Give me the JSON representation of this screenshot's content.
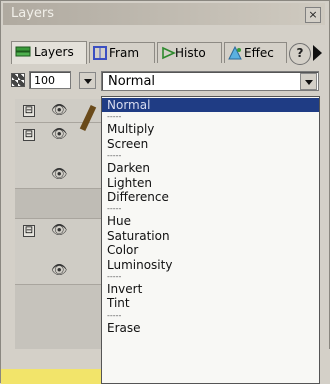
{
  "window": {
    "title": "Layers",
    "close_glyph": "×"
  },
  "tabs": [
    {
      "label": "Layers",
      "icon": "layers-icon"
    },
    {
      "label": "Fram",
      "icon": "frames-icon"
    },
    {
      "label": "Histo",
      "icon": "history-icon"
    },
    {
      "label": "Effec",
      "icon": "effects-icon"
    }
  ],
  "help": {
    "glyph": "?"
  },
  "opacity": {
    "value": "100",
    "icon": "opacity-icon"
  },
  "blend_mode": {
    "selected": "Normal"
  },
  "layer_rows": {
    "expander_glyph": "⊟",
    "eye_glyph": "👁"
  },
  "blend_options": [
    {
      "label": "Normal",
      "selected": true
    },
    {
      "label": "-----"
    },
    {
      "label": "Multiply"
    },
    {
      "label": "Screen"
    },
    {
      "label": "-----"
    },
    {
      "label": "Darken"
    },
    {
      "label": "Lighten"
    },
    {
      "label": "Difference"
    },
    {
      "label": "-----"
    },
    {
      "label": "Hue"
    },
    {
      "label": "Saturation"
    },
    {
      "label": "Color"
    },
    {
      "label": "Luminosity"
    },
    {
      "label": "-----"
    },
    {
      "label": "Invert"
    },
    {
      "label": "Tint"
    },
    {
      "label": "-----"
    },
    {
      "label": "Erase"
    }
  ]
}
